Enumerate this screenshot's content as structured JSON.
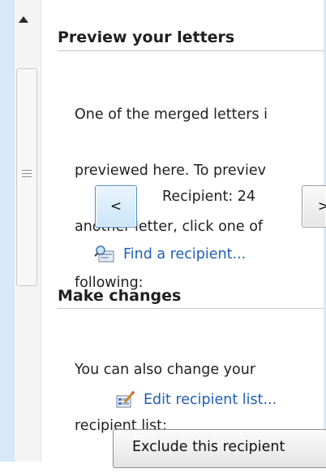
{
  "preview": {
    "title": "Preview your letters",
    "description_lines": [
      "One of the merged letters i",
      "previewed here. To previev",
      "another letter, click one of",
      "following:"
    ],
    "prev_button_label": "<",
    "next_button_label": ">",
    "recipient_text": "Recipient: 24",
    "find_recipient_link": "Find a recipient..."
  },
  "changes": {
    "title": "Make changes",
    "description_lines": [
      "You can also change your",
      "recipient list:"
    ],
    "edit_list_link": "Edit recipient list...",
    "exclude_button_label": "Exclude this recipient"
  },
  "icons": {
    "scroll_up": "triangle-up-icon",
    "scroll_grip": "grip-icon",
    "find_recipient": "find-recipient-icon",
    "edit_list": "edit-list-icon"
  },
  "colors": {
    "link": "#1f5fb6",
    "window_edge": "#d7e8fa",
    "active_button_border": "#4f8cc9"
  }
}
